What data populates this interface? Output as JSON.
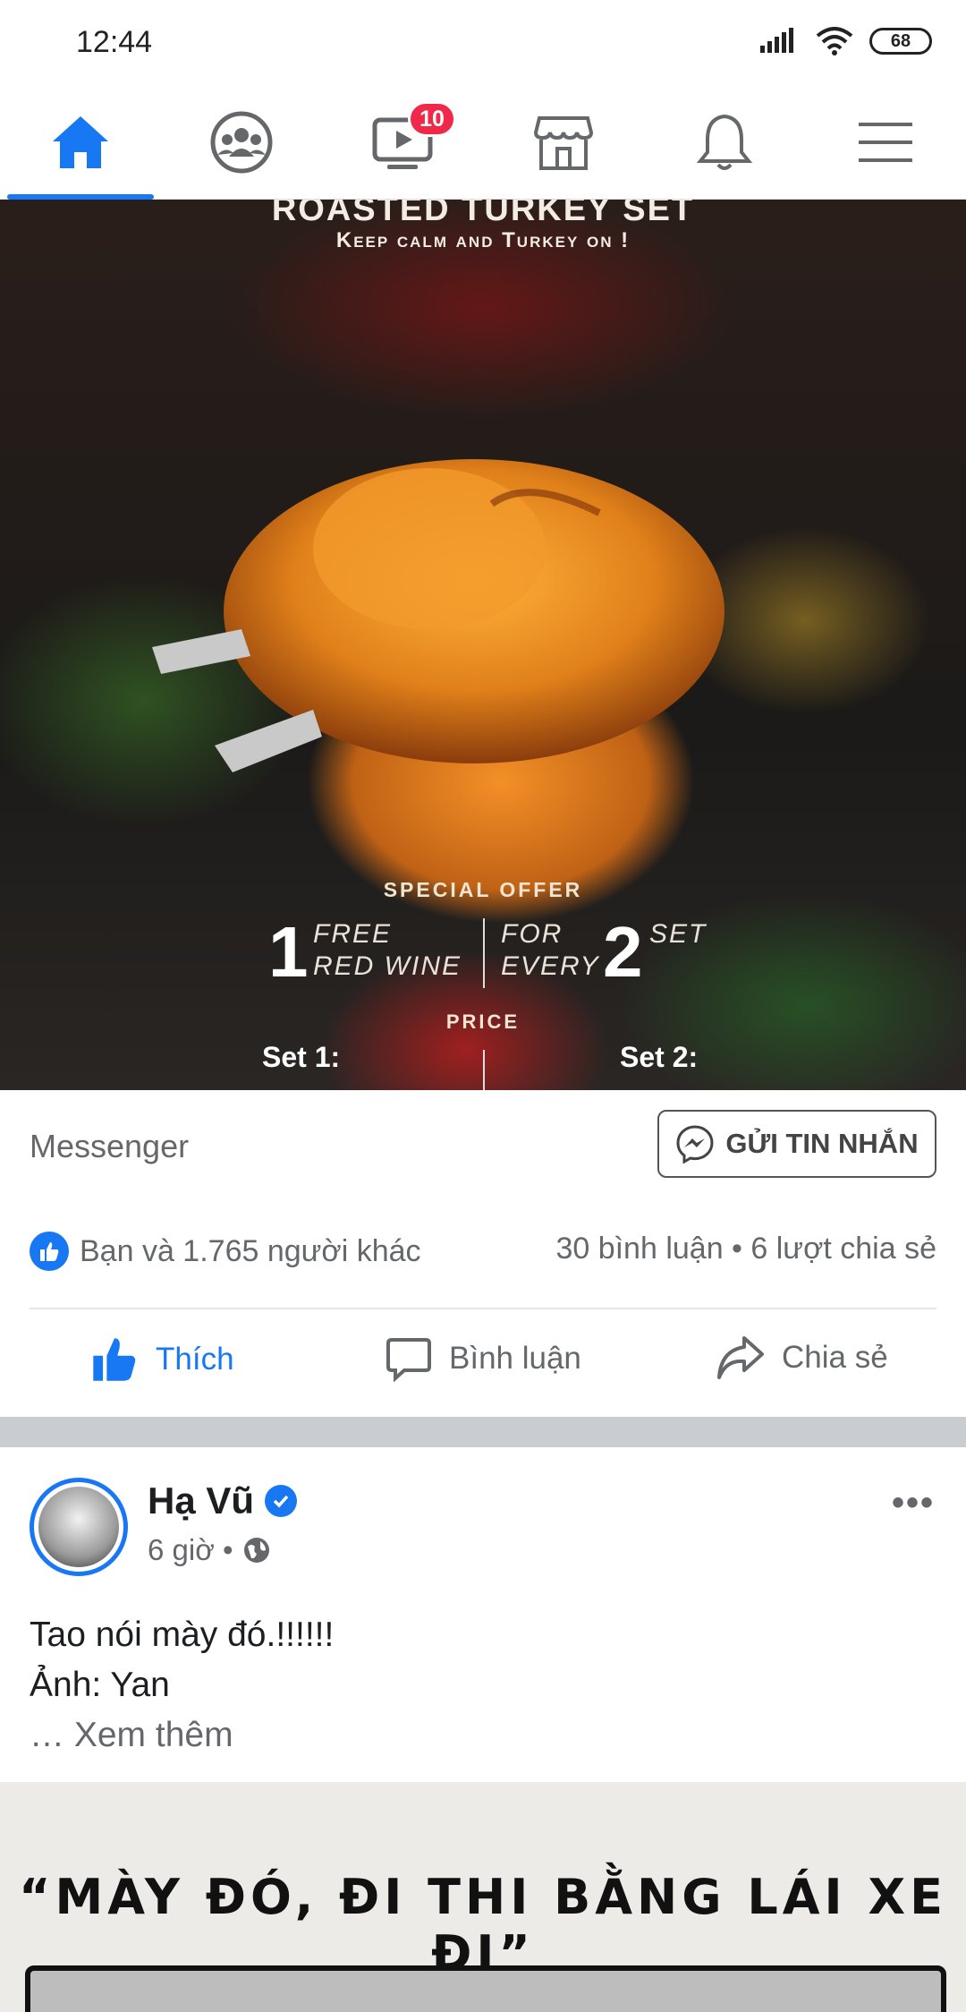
{
  "status_bar": {
    "time": "12:44",
    "battery": "68"
  },
  "nav": {
    "items": [
      {
        "name": "home",
        "active": true
      },
      {
        "name": "groups"
      },
      {
        "name": "watch",
        "badge": "10"
      },
      {
        "name": "marketplace"
      },
      {
        "name": "notifications"
      },
      {
        "name": "menu"
      }
    ]
  },
  "ad": {
    "title": "ROASTED TURKEY SET",
    "subtitle": "Keep calm and Turkey on !",
    "special_offer": "SPECIAL OFFER",
    "offer_big_1": "1",
    "offer_free": "FREE",
    "offer_red_wine": "RED WINE",
    "offer_for": "FOR",
    "offer_every": "EVERY",
    "offer_big_2": "2",
    "offer_set": "SET",
    "price_label": "PRICE",
    "set1": "Set 1:",
    "set2": "Set 2:"
  },
  "cta": {
    "label": "Messenger",
    "button": "GỬI TIN NHẮN"
  },
  "reactions": {
    "likes": "Bạn và 1.765 người khác",
    "stats": "30 bình luận • 6 lượt chia sẻ"
  },
  "actions": {
    "like": "Thích",
    "comment": "Bình luận",
    "share": "Chia sẻ"
  },
  "post2": {
    "author": "Hạ Vũ",
    "time": "6 giờ •",
    "more": "•••",
    "line1": "Tao nói mày đó.!!!!!!",
    "line2": "Ảnh: Yan",
    "see_more": "… Xem thêm"
  },
  "meme": {
    "caption": "“MÀY ĐÓ, ĐI THI BẰNG LÁI XE ĐI”"
  },
  "colors": {
    "brand": "#1877f2",
    "badge": "#f02849",
    "text_secondary": "#65676b"
  }
}
